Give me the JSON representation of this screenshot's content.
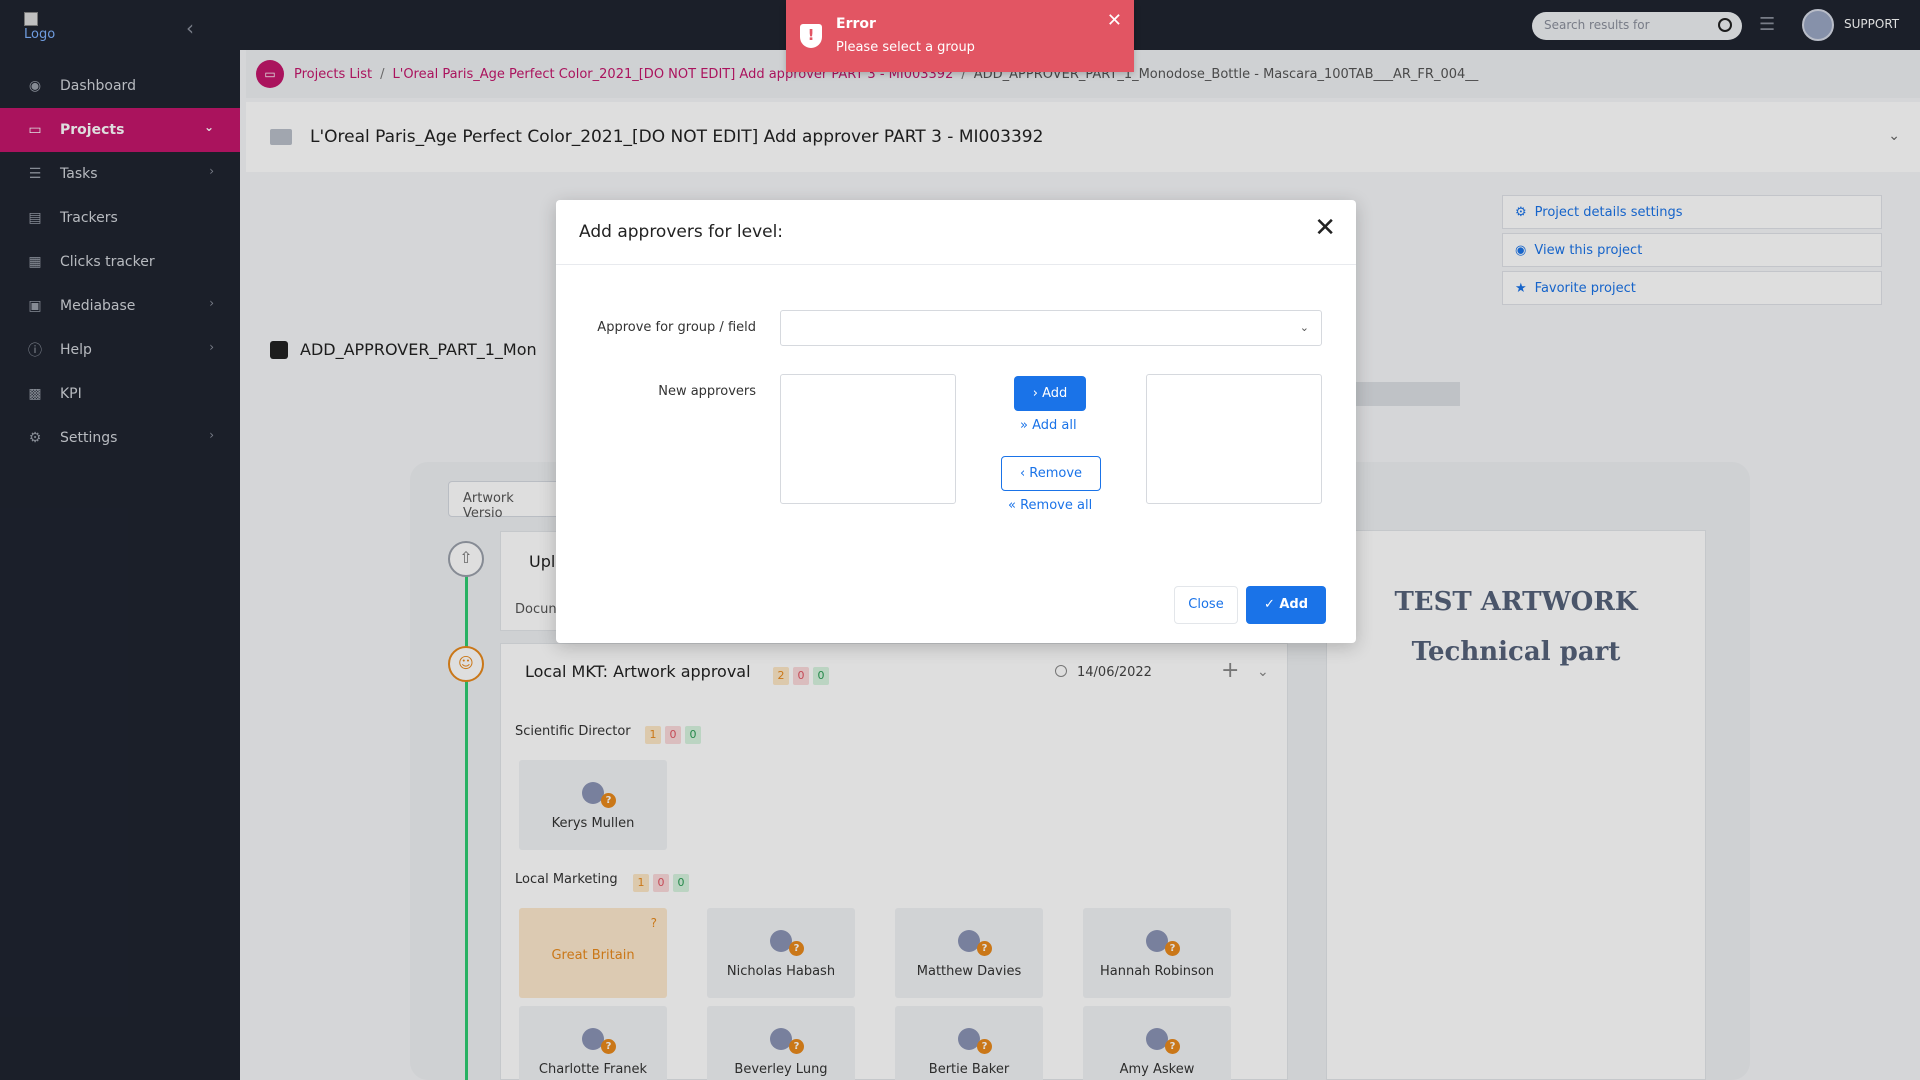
{
  "sidebar": {
    "logo_text": "Logo",
    "items": [
      {
        "label": "Dashboard",
        "icon": "cube-icon",
        "chevron": false,
        "active": false
      },
      {
        "label": "Projects",
        "icon": "folder-open-icon",
        "chevron": true,
        "active": true
      },
      {
        "label": "Tasks",
        "icon": "list-icon",
        "chevron": true,
        "active": false
      },
      {
        "label": "Trackers",
        "icon": "clipboard-icon",
        "chevron": false,
        "active": false
      },
      {
        "label": "Clicks tracker",
        "icon": "building-icon",
        "chevron": false,
        "active": false
      },
      {
        "label": "Mediabase",
        "icon": "image-icon",
        "chevron": true,
        "active": false
      },
      {
        "label": "Help",
        "icon": "info-icon",
        "chevron": true,
        "active": false
      },
      {
        "label": "KPI",
        "icon": "bar-chart-icon",
        "chevron": false,
        "active": false
      },
      {
        "label": "Settings",
        "icon": "gear-icon",
        "chevron": true,
        "active": false
      }
    ]
  },
  "topbar": {
    "search_placeholder": "Search results for",
    "user_label": "SUPPORT"
  },
  "breadcrumb": {
    "root": "Projects List",
    "project": "L'Oreal Paris_Age Perfect Color_2021_[DO NOT EDIT] Add approver PART 3 - MI003392",
    "current": "ADD_APPROVER_PART_1_Monodose_Bottle - Mascara_100TAB___AR_FR_004__"
  },
  "project_header": {
    "title": "L'Oreal Paris_Age Perfect Color_2021_[DO NOT EDIT] Add approver PART 3 - MI003392"
  },
  "side_links": [
    {
      "label": "Project details settings",
      "icon": "gear-icon"
    },
    {
      "label": "View this project",
      "icon": "eye-icon"
    },
    {
      "label": "Favorite project",
      "icon": "star-icon"
    }
  ],
  "artwork": {
    "title": "ADD_APPROVER_PART_1_Mon",
    "tab_label": "Artwork Versio",
    "upload_title": "Upl",
    "upload_doc": "Docun"
  },
  "level": {
    "title": "Local MKT: Artwork approval",
    "badges": [
      "2",
      "0",
      "0"
    ],
    "date": "14/06/2022",
    "groups": [
      {
        "label": "Scientific Director",
        "badges": [
          "1",
          "0",
          "0"
        ],
        "people": [
          "Kerys Mullen"
        ]
      },
      {
        "label": "Local Marketing",
        "badges": [
          "1",
          "0",
          "0"
        ],
        "people": [
          "Great Britain",
          "Nicholas Habash",
          "Matthew Davies",
          "Hannah Robinson",
          "Charlotte Franek",
          "Beverley Lung",
          "Bertie Baker",
          "Amy Askew"
        ]
      }
    ]
  },
  "preview": {
    "line1": "TEST ARTWORK",
    "line2": "Technical part"
  },
  "modal": {
    "title": "Add approvers for level:",
    "group_label": "Approve for group / field",
    "group_value": "",
    "new_approvers_label": "New approvers",
    "add_label": "Add",
    "add_all_label": "Add all",
    "remove_label": "Remove",
    "remove_all_label": "Remove all",
    "close_label": "Close",
    "submit_label": "Add"
  },
  "toast": {
    "title": "Error",
    "message": "Please select a group"
  },
  "colors": {
    "brand": "#c4166b",
    "primary": "#1a73e8",
    "error": "#e25563",
    "sidebar_bg": "#1f2430"
  }
}
